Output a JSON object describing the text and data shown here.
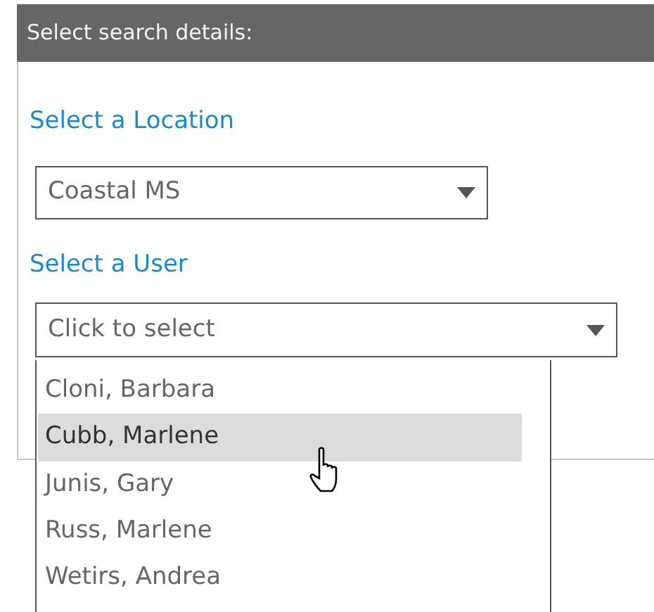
{
  "panel": {
    "title": "Select search details:"
  },
  "location": {
    "label": "Select a Location",
    "value": "Coastal MS"
  },
  "user": {
    "label": "Select a User",
    "placeholder": "Click to select",
    "expanded": true,
    "options": [
      {
        "label": "Cloni, Barbara",
        "selected": false
      },
      {
        "label": "Cubb, Marlene",
        "selected": true
      },
      {
        "label": "Junis, Gary",
        "selected": false
      },
      {
        "label": "Russ, Marlene",
        "selected": false
      },
      {
        "label": "Wetirs, Andrea",
        "selected": false
      }
    ]
  }
}
